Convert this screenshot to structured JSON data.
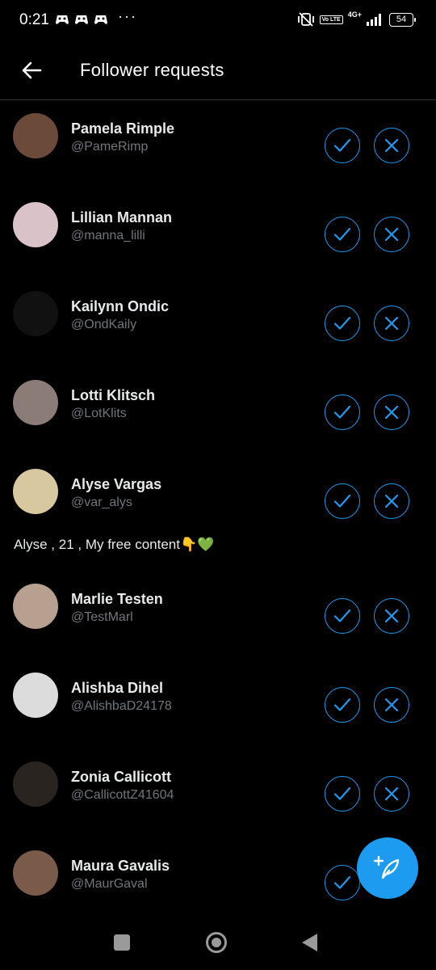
{
  "status_bar": {
    "time": "0:21",
    "dots": "···",
    "volte": "Vo LTE",
    "network": "4G+",
    "battery": "54"
  },
  "header": {
    "title": "Follower requests"
  },
  "requests": [
    {
      "name": "Pamela Rimple",
      "handle": "@PameRimp",
      "bio": ""
    },
    {
      "name": "Lillian Mannan",
      "handle": "@manna_lilli",
      "bio": ""
    },
    {
      "name": "Kailynn Ondic",
      "handle": "@OndKaily",
      "bio": ""
    },
    {
      "name": "Lotti Klitsch",
      "handle": "@LotKlits",
      "bio": ""
    },
    {
      "name": "Alyse Vargas",
      "handle": "@var_alys",
      "bio": "Alyse , 21 , My free content👇💚"
    },
    {
      "name": "Marlie Testen",
      "handle": "@TestMarl",
      "bio": ""
    },
    {
      "name": "Alishba Dihel",
      "handle": "@AlishbaD24178",
      "bio": ""
    },
    {
      "name": "Zonia Callicott",
      "handle": "@CallicottZ41604",
      "bio": ""
    },
    {
      "name": "Maura Gavalis",
      "handle": "@MaurGaval",
      "bio": ""
    }
  ],
  "avatar_colors": [
    "#6b4a3a",
    "#d9c2c8",
    "#111111",
    "#8c7c78",
    "#d8c8a0",
    "#b8a090",
    "#dcdcdc",
    "#2a2420",
    "#7a5a48"
  ],
  "colors": {
    "accent": "#1d9bf0",
    "background": "#000000",
    "secondary_text": "#71767b"
  },
  "icons": {
    "back": "arrow-left-icon",
    "accept": "checkmark-icon",
    "decline": "x-icon",
    "compose": "feather-plus-icon"
  }
}
